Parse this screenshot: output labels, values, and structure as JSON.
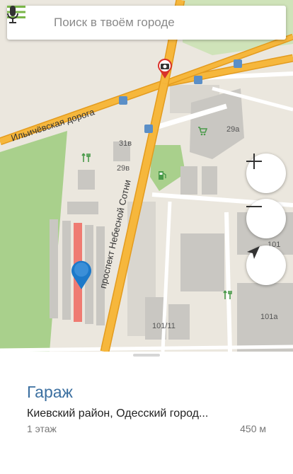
{
  "search": {
    "placeholder": "Поиск в твоём городе"
  },
  "map": {
    "road_labels": {
      "ilyichevskaya": "Ильичёвская дорога",
      "prospekt": "проспект Небесной Сотни"
    },
    "building_labels": {
      "b29a": "29а",
      "b31v": "31в",
      "b29v": "29в",
      "b101": "101",
      "b101_11": "101/11",
      "b101a": "101а"
    },
    "colors": {
      "road_major": "#f6b73c",
      "road_border": "#e39b1e",
      "park_green": "#8bbf6b",
      "pin_blue": "#1d79c9",
      "highlight_red": "#ef7b72"
    },
    "icons": [
      "camera-icon",
      "bus-stop-icon",
      "shopping-cart-icon",
      "fuel-icon",
      "service-tools-icon",
      "location-pin-icon"
    ]
  },
  "controls": {
    "zoom_in": "zoom-in",
    "zoom_out": "zoom-out",
    "my_location": "my-location"
  },
  "place": {
    "title": "Гараж",
    "address": "Киевский район, Одесский город...",
    "floor": "1 этаж",
    "distance": "450 м"
  }
}
